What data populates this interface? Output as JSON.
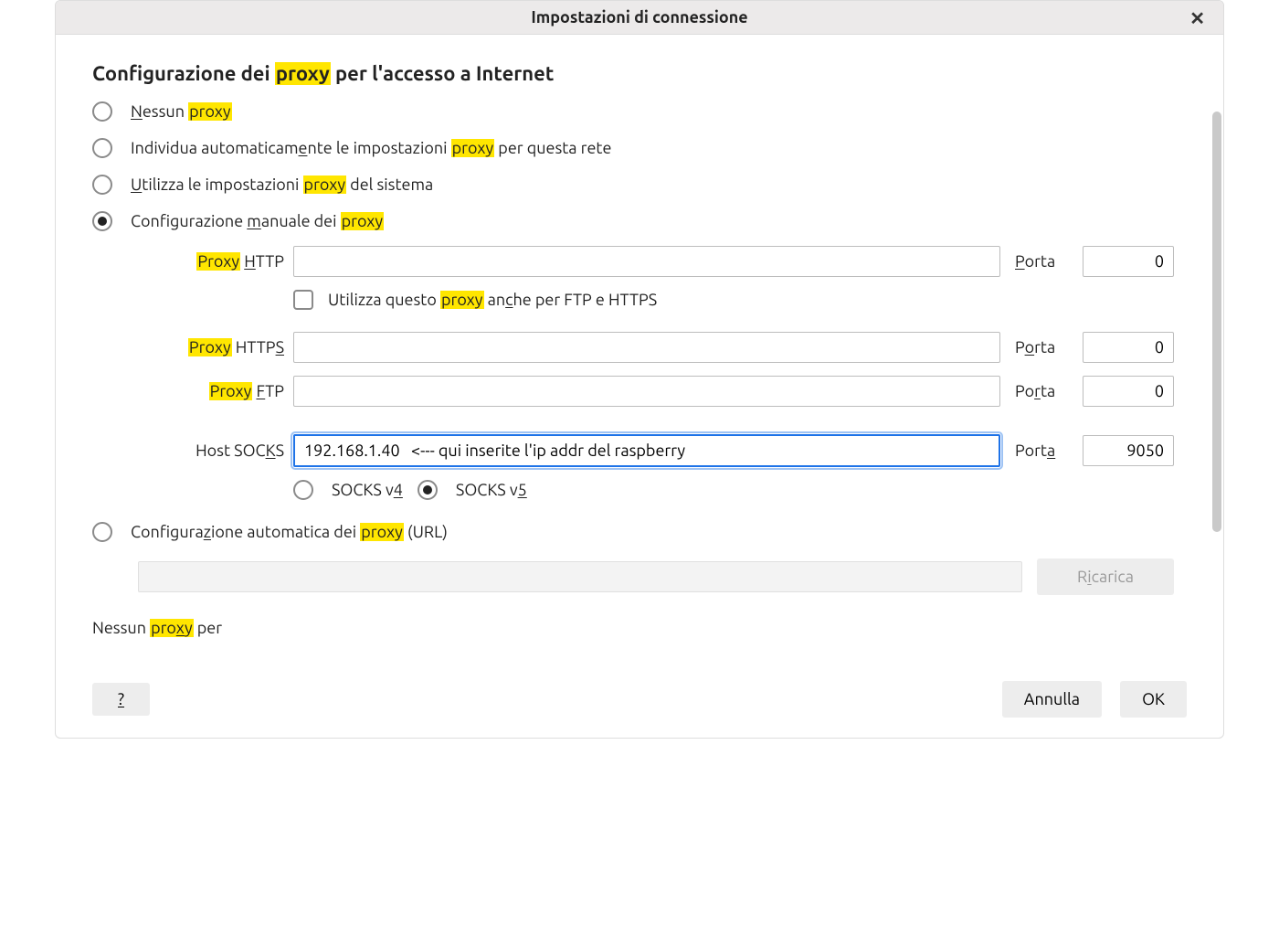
{
  "window": {
    "title": "Impostazioni di connessione"
  },
  "heading": {
    "pre": "Configurazione dei ",
    "hl": "proxy",
    "post": " per l'accesso a Internet"
  },
  "options": {
    "none": {
      "pre": "",
      "u": "N",
      "mid": "essun ",
      "hl": "proxy",
      "post": ""
    },
    "auto_detect": {
      "pre": "Individua automaticam",
      "u": "e",
      "mid": "nte le impostazioni ",
      "hl": "proxy",
      "post": " per questa rete"
    },
    "system": {
      "pre": "",
      "u": "U",
      "mid": "tilizza le impostazioni ",
      "hl": "proxy",
      "post": " del sistema"
    },
    "manual": {
      "pre": "Configurazione ",
      "u": "m",
      "mid": "anuale dei ",
      "hl": "proxy",
      "post": ""
    },
    "auto_url": {
      "pre": "Configura",
      "u": "z",
      "mid": "ione automatica dei ",
      "hl": "proxy",
      "post": " (URL)"
    },
    "selected": "manual"
  },
  "fields": {
    "http": {
      "label_hl": "Proxy",
      "label_u": "H",
      "label_post": "TTP",
      "value": "",
      "port_label_u": "P",
      "port_label_post": "orta",
      "port": "0"
    },
    "use_for_all": {
      "pre": "Utilizza questo ",
      "hl": "proxy",
      "mid": " an",
      "u": "c",
      "post": "he per FTP e HTTPS",
      "checked": false
    },
    "https": {
      "label_hl": "Proxy",
      "label_mid": " HTTP",
      "label_u": "S",
      "value": "",
      "port_pre": "P",
      "port_u": "o",
      "port_post": "rta",
      "port": "0"
    },
    "ftp": {
      "label_hl": "Proxy",
      "label_mid": " ",
      "label_u": "F",
      "label_post": "TP",
      "value": "",
      "port_pre": "Po",
      "port_u": "r",
      "port_post": "ta",
      "port": "0"
    },
    "socks": {
      "label_pre": "Host SOC",
      "label_u": "K",
      "label_post": "S",
      "value": "192.168.1.40   <--- qui inserite l'ip addr del raspberry",
      "port_pre": "Port",
      "port_u": "a",
      "port_post": "",
      "port": "9050"
    },
    "socks_version": {
      "v4_pre": "SOCKS v",
      "v4_u": "4",
      "v5_pre": "SOCKS v",
      "v5_u": "5",
      "selected": "v5"
    },
    "auto_url": {
      "value": ""
    },
    "reload_label": {
      "pre": "R",
      "u": "i",
      "post": "carica"
    }
  },
  "noproxy": {
    "pre": "Nessun ",
    "hl_pre": "pro",
    "hl_u": "x",
    "hl_post": "y",
    "post": " per"
  },
  "footer": {
    "help": "?",
    "cancel": "Annulla",
    "ok": "OK"
  }
}
